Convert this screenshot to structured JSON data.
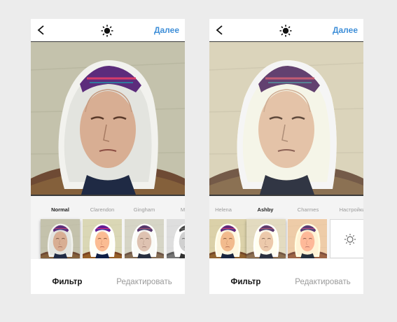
{
  "colors": {
    "accent": "#3f8fd8",
    "background": "#ececec"
  },
  "icons": {
    "back": "chevron-left-icon",
    "adjust": "sun-brightness-icon",
    "settings": "sun-settings-icon"
  },
  "screens": [
    {
      "next_label": "Далее",
      "filters": [
        {
          "name": "Normal",
          "selected": true
        },
        {
          "name": "Clarendon",
          "selected": false
        },
        {
          "name": "Gingham",
          "selected": false
        },
        {
          "name": "M",
          "selected": false
        }
      ],
      "tabs": {
        "filter": "Фильтр",
        "edit": "Редактировать"
      }
    },
    {
      "next_label": "Далее",
      "filters": [
        {
          "name": "Helena",
          "selected": false
        },
        {
          "name": "Ashby",
          "selected": true
        },
        {
          "name": "Charmes",
          "selected": false
        },
        {
          "name": "Настройки",
          "selected": false
        }
      ],
      "tabs": {
        "filter": "Фильтр",
        "edit": "Редактировать"
      }
    }
  ]
}
